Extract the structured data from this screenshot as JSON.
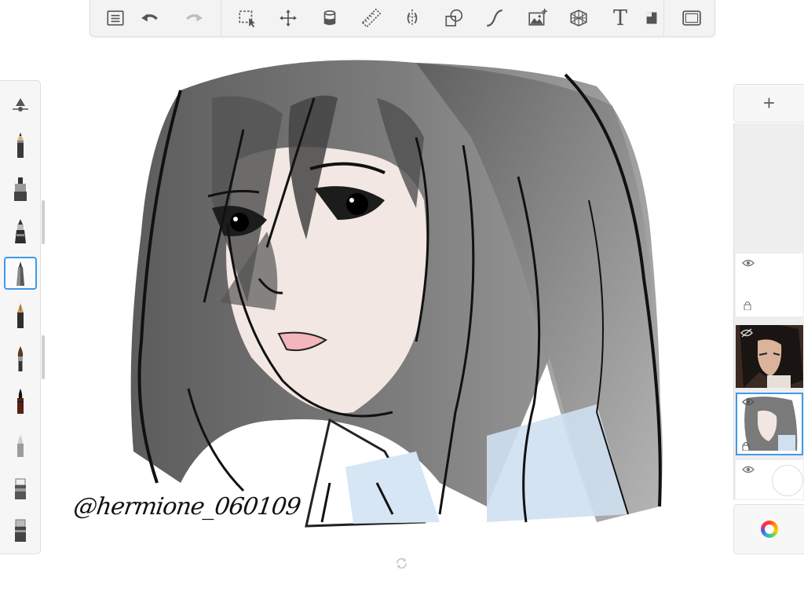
{
  "toolbar": {
    "items": [
      {
        "id": "list",
        "icon": "list-icon"
      },
      {
        "id": "undo",
        "icon": "undo-icon"
      },
      {
        "id": "redo",
        "icon": "redo-icon"
      },
      {
        "id": "select",
        "icon": "selection-icon"
      },
      {
        "id": "transform",
        "icon": "move-icon"
      },
      {
        "id": "fill",
        "icon": "fill-bucket-icon"
      },
      {
        "id": "ruler",
        "icon": "ruler-icon"
      },
      {
        "id": "symmetry",
        "icon": "symmetry-icon"
      },
      {
        "id": "shapes",
        "icon": "shapes-icon"
      },
      {
        "id": "stroke",
        "icon": "curve-icon"
      },
      {
        "id": "image",
        "icon": "add-image-icon"
      },
      {
        "id": "perspective",
        "icon": "perspective-grid-icon"
      },
      {
        "id": "text",
        "icon": "text-icon"
      },
      {
        "id": "window",
        "icon": "fullscreen-icon"
      }
    ],
    "text_label": "T"
  },
  "brushes": [
    "brush-size-opacity-icon",
    "pencil-icon",
    "marker-icon",
    "airbrush-icon",
    "ballpoint-pen-icon",
    "fountain-pen-icon",
    "paintbrush-icon",
    "ink-brush-icon",
    "smudge-icon",
    "eraser-icon",
    "hard-eraser-icon"
  ],
  "selected_brush": "ballpoint-pen-icon",
  "canvas": {
    "signature": "@hermione_060109"
  },
  "layers": {
    "add_label": "+",
    "items": [
      {
        "name": "empty-layer",
        "visible": true,
        "locked": true
      },
      {
        "name": "reference-photo-layer",
        "visible": false,
        "locked": false
      },
      {
        "name": "drawing-layer",
        "visible": true,
        "locked": true,
        "selected": true
      },
      {
        "name": "background-layer",
        "visible": true,
        "locked": false
      }
    ]
  },
  "colors": {
    "accent": "#3f9ae8",
    "panel": "#f3f3f3"
  }
}
